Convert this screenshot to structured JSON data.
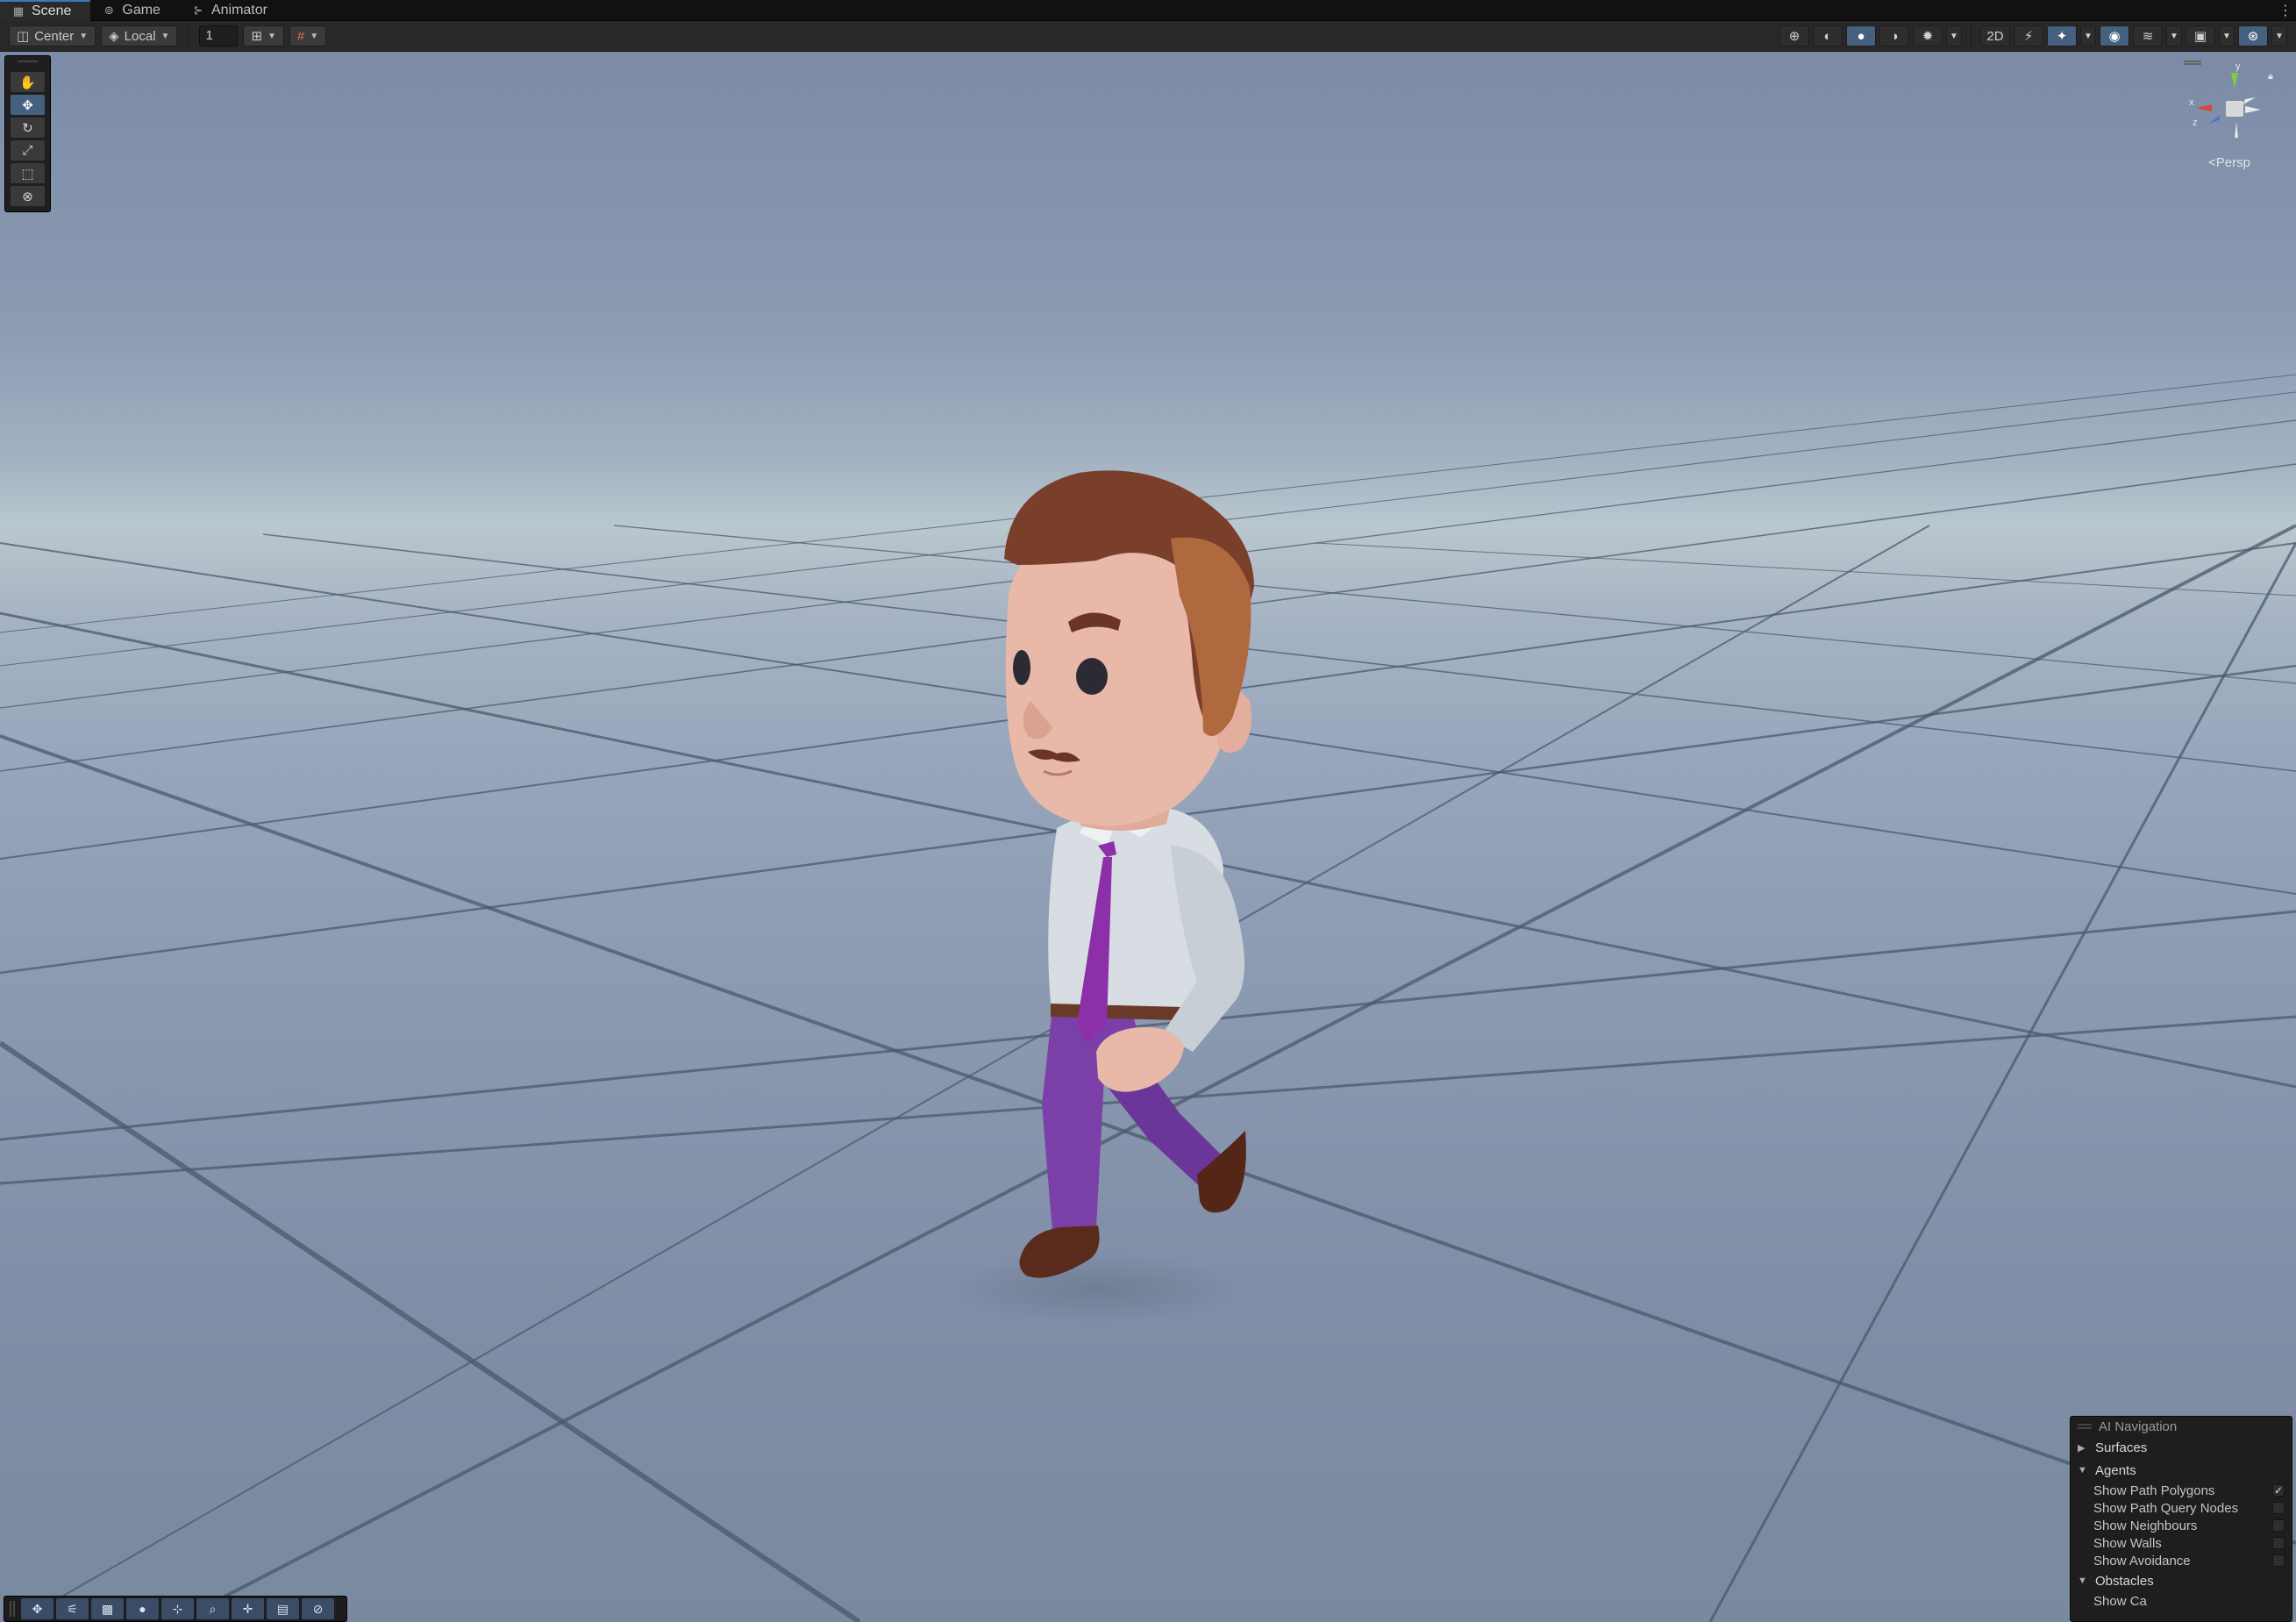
{
  "tabs": [
    {
      "label": "Scene",
      "icon": "grid-icon"
    },
    {
      "label": "Game",
      "icon": "gamepad-icon"
    },
    {
      "label": "Animator",
      "icon": "animator-icon"
    }
  ],
  "toolbar": {
    "pivot_mode": "Center",
    "pivot_rotation": "Local",
    "grid_snap_value": "1"
  },
  "gizmo": {
    "projection": "Persp",
    "axis_labels": {
      "x": "x",
      "y": "y",
      "z": "z"
    }
  },
  "ai_navigation": {
    "title": "AI Navigation",
    "surfaces_label": "Surfaces",
    "agents_label": "Agents",
    "agent_options": [
      {
        "label": "Show Path Polygons",
        "checked": true
      },
      {
        "label": "Show Path Query Nodes",
        "checked": false
      },
      {
        "label": "Show Neighbours",
        "checked": false
      },
      {
        "label": "Show Walls",
        "checked": false
      },
      {
        "label": "Show Avoidance",
        "checked": false
      }
    ],
    "obstacles_label": "Obstacles",
    "obstacle_partial_label": "Show Ca"
  },
  "colors": {
    "accent": "#46607f",
    "tab_highlight": "#3a79bb",
    "sky": "#7b8ba6",
    "horizon": "#b9c7cf",
    "ground": "#8b99b1",
    "shirt": "#d7dde3",
    "tie": "#8c2fa8",
    "pants": "#7a40a8",
    "hair": "#7a3f2a",
    "skin": "#e8b8a8",
    "shoes": "#5a2b1c"
  }
}
